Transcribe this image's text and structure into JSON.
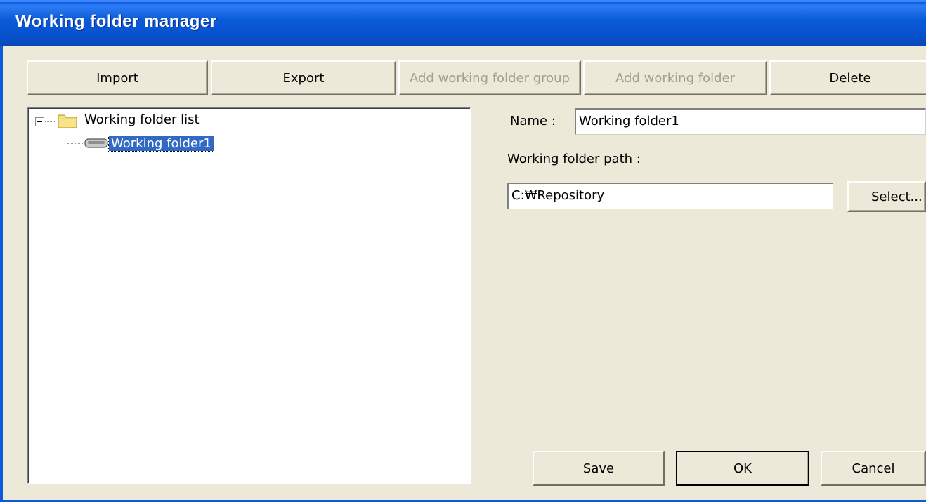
{
  "window": {
    "title": "Working folder manager"
  },
  "toolbar": {
    "import_label": "Import",
    "export_label": "Export",
    "add_group_label": "Add working folder group",
    "add_folder_label": "Add working folder",
    "delete_label": "Delete"
  },
  "tree": {
    "root_label": "Working folder list",
    "child_label": "Working folder1",
    "root_expanded": true,
    "selected": "Working folder1"
  },
  "details": {
    "name_label": "Name :",
    "name_value": "Working folder1",
    "path_label": "Working folder path :",
    "path_value": "C:₩Repository",
    "select_label": "Select..."
  },
  "footer": {
    "save_label": "Save",
    "ok_label": "OK",
    "cancel_label": "Cancel"
  },
  "colors": {
    "titlebar": "#0a5bd8",
    "dialog_bg": "#ece9d8",
    "selection": "#316ac5",
    "disabled_text": "#a19f94"
  }
}
